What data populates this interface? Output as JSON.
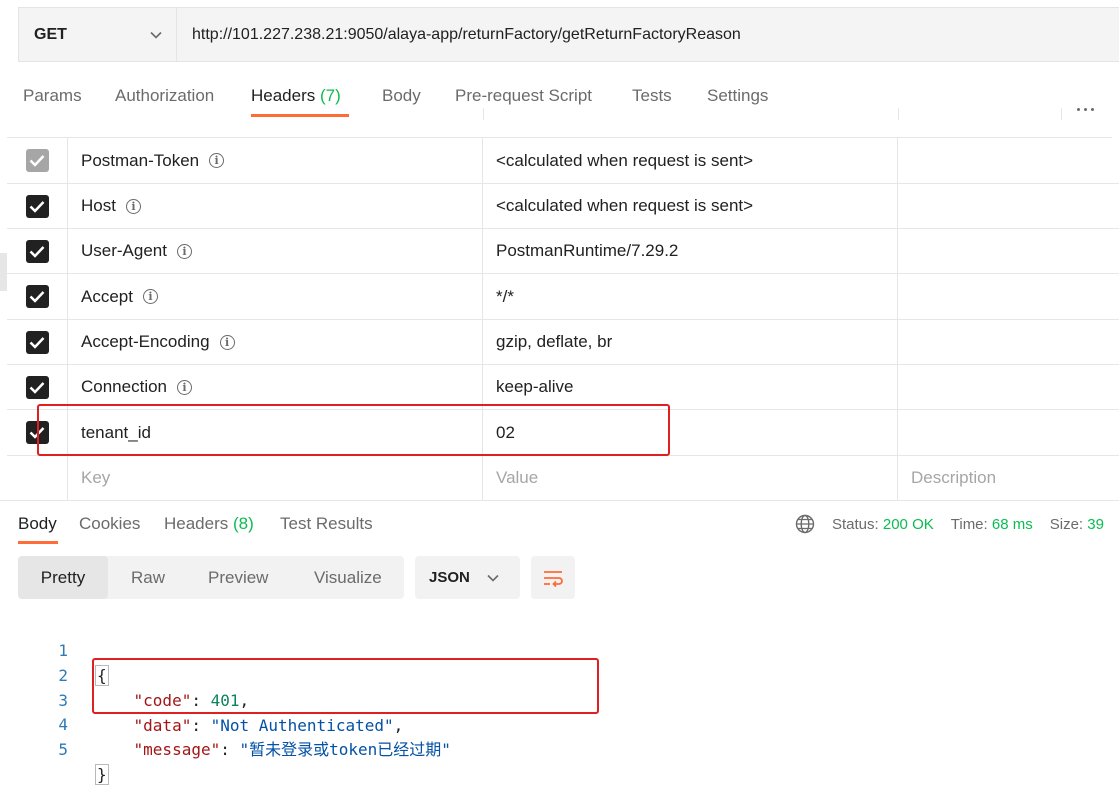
{
  "request": {
    "method": "GET",
    "url": "http://101.227.238.21:9050/alaya-app/returnFactory/getReturnFactoryReason"
  },
  "request_tabs": [
    {
      "label": "Params"
    },
    {
      "label": "Authorization"
    },
    {
      "label": "Headers",
      "count": "(7)",
      "active": true
    },
    {
      "label": "Body"
    },
    {
      "label": "Pre-request Script"
    },
    {
      "label": "Tests"
    },
    {
      "label": "Settings"
    }
  ],
  "headers_table": {
    "rows": [
      {
        "key": "Postman-Token",
        "value": "<calculated when request is sent>",
        "checked": true,
        "disabled": true,
        "info": true
      },
      {
        "key": "Host",
        "value": "<calculated when request is sent>",
        "checked": true,
        "info": true
      },
      {
        "key": "User-Agent",
        "value": "PostmanRuntime/7.29.2",
        "checked": true,
        "info": true
      },
      {
        "key": "Accept",
        "value": "*/*",
        "checked": true,
        "info": true
      },
      {
        "key": "Accept-Encoding",
        "value": "gzip, deflate, br",
        "checked": true,
        "info": true
      },
      {
        "key": "Connection",
        "value": "keep-alive",
        "checked": true,
        "info": true
      },
      {
        "key": "tenant_id",
        "value": "02",
        "checked": true,
        "info": false
      }
    ],
    "new_row": {
      "key_placeholder": "Key",
      "value_placeholder": "Value",
      "description_placeholder": "Description"
    }
  },
  "response_tabs": [
    {
      "label": "Body",
      "active": true
    },
    {
      "label": "Cookies"
    },
    {
      "label": "Headers",
      "count": "(8)"
    },
    {
      "label": "Test Results"
    }
  ],
  "response_status": {
    "status_label": "Status:",
    "status_value": "200 OK",
    "time_label": "Time:",
    "time_value": "68 ms",
    "size_label": "Size:",
    "size_value": "39"
  },
  "view_modes": [
    "Pretty",
    "Raw",
    "Preview",
    "Visualize"
  ],
  "format": "JSON",
  "response_body": {
    "line_numbers": [
      "1",
      "2",
      "3",
      "4",
      "5"
    ],
    "open_brace": "{",
    "close_brace": "}",
    "code_key": "\"code\"",
    "code_value": "401",
    "data_key": "\"data\"",
    "data_value": "\"Not Authenticated\"",
    "message_key": "\"message\"",
    "message_value": "\"暂未登录或token已经过期\""
  },
  "colors": {
    "accent": "#ff6c37",
    "success": "#0cbb52",
    "highlight_box": "#e02020"
  }
}
